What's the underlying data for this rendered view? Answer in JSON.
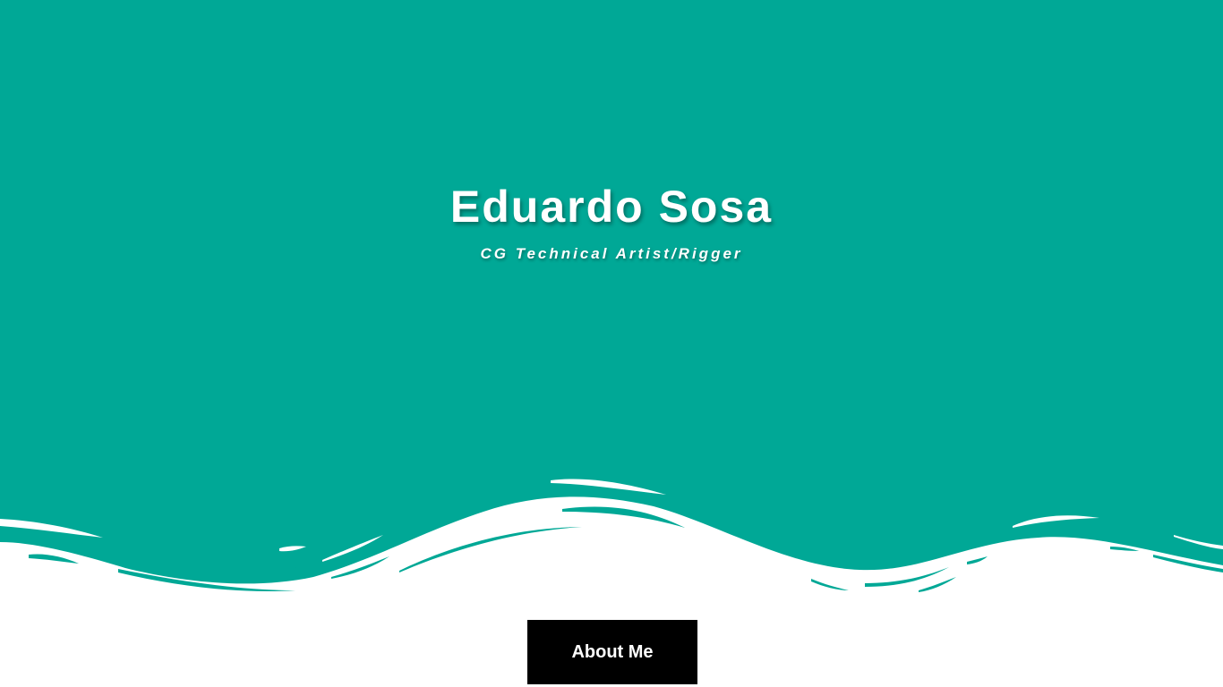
{
  "hero": {
    "title": "Eduardo Sosa",
    "subtitle": "CG Technical Artist/Rigger"
  },
  "buttons": {
    "about_label": "About Me"
  },
  "colors": {
    "hero_background": "#00a896",
    "page_background": "#ffffff",
    "button_background": "#000000",
    "text": "#ffffff"
  }
}
